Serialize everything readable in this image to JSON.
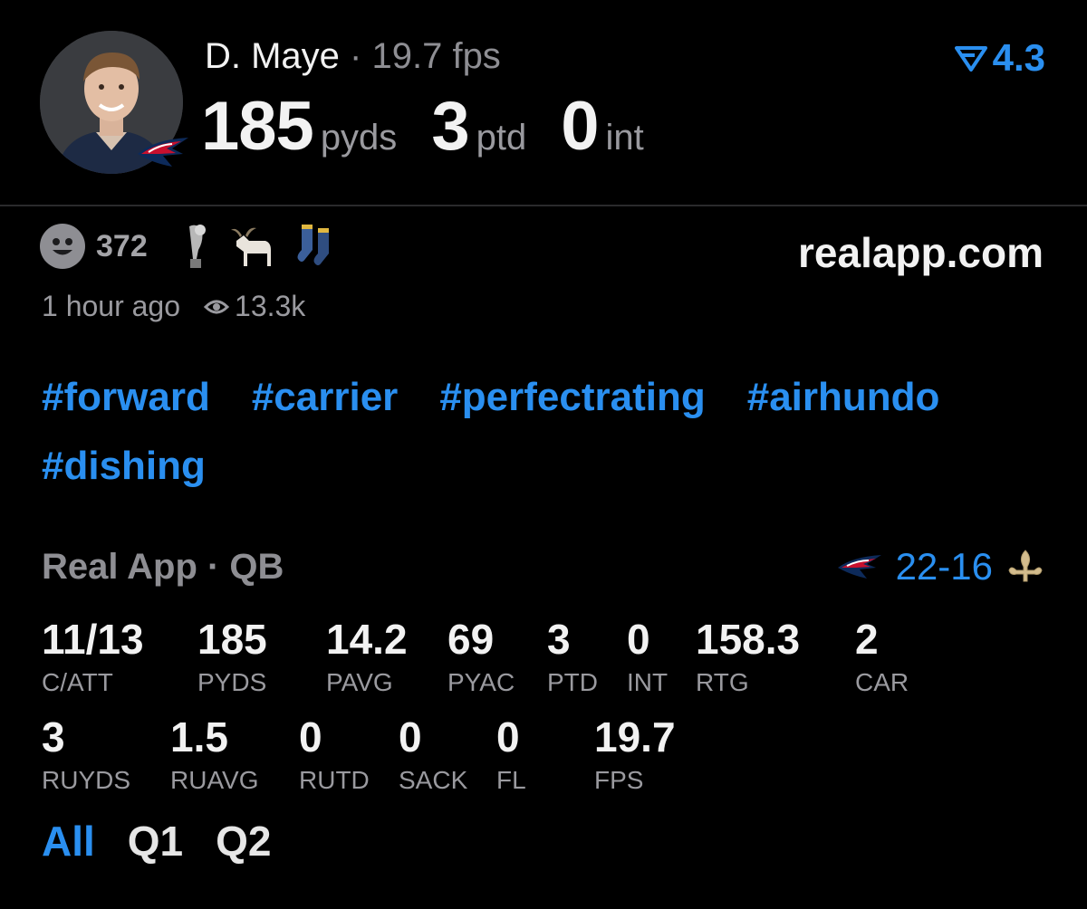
{
  "header": {
    "player_name": "D. Maye",
    "separator": " · ",
    "fps_text": "19.7 fps",
    "rating": "4.3",
    "headline": [
      {
        "value": "185",
        "unit": "pyds"
      },
      {
        "value": "3",
        "unit": "ptd"
      },
      {
        "value": "0",
        "unit": "int"
      }
    ]
  },
  "reactions": {
    "count": "372",
    "icons": [
      "smiley-icon",
      "trophy-icon",
      "goat-icon",
      "socks-icon"
    ]
  },
  "domain": "realapp.com",
  "meta": {
    "time": "1 hour ago",
    "views": "13.3k"
  },
  "tags": [
    "#forward",
    "#carrier",
    "#perfectrating",
    "#airhundo",
    "#dishing"
  ],
  "game": {
    "label": "Real App · QB",
    "score_home": "22",
    "score_dash": "-",
    "score_away": "16",
    "home_logo": "patriots-logo",
    "away_logo": "saints-fleur-de-lis"
  },
  "stats_row1": [
    {
      "value": "11/13",
      "label": "C/ATT"
    },
    {
      "value": "185",
      "label": "PYDS"
    },
    {
      "value": "14.2",
      "label": "PAVG"
    },
    {
      "value": "69",
      "label": "PYAC"
    },
    {
      "value": "3",
      "label": "PTD"
    },
    {
      "value": "0",
      "label": "INT"
    },
    {
      "value": "158.3",
      "label": "RTG"
    },
    {
      "value": "2",
      "label": "CAR"
    }
  ],
  "stats_row2": [
    {
      "value": "3",
      "label": "RUYDS"
    },
    {
      "value": "1.5",
      "label": "RUAVG"
    },
    {
      "value": "0",
      "label": "RUTD"
    },
    {
      "value": "0",
      "label": "SACK"
    },
    {
      "value": "0",
      "label": "FL"
    },
    {
      "value": "19.7",
      "label": "FPS"
    }
  ],
  "filters": [
    "All",
    "Q1",
    "Q2"
  ],
  "colors": {
    "accent": "#2a8ff0",
    "background": "#000000",
    "muted": "#8e8e93"
  }
}
